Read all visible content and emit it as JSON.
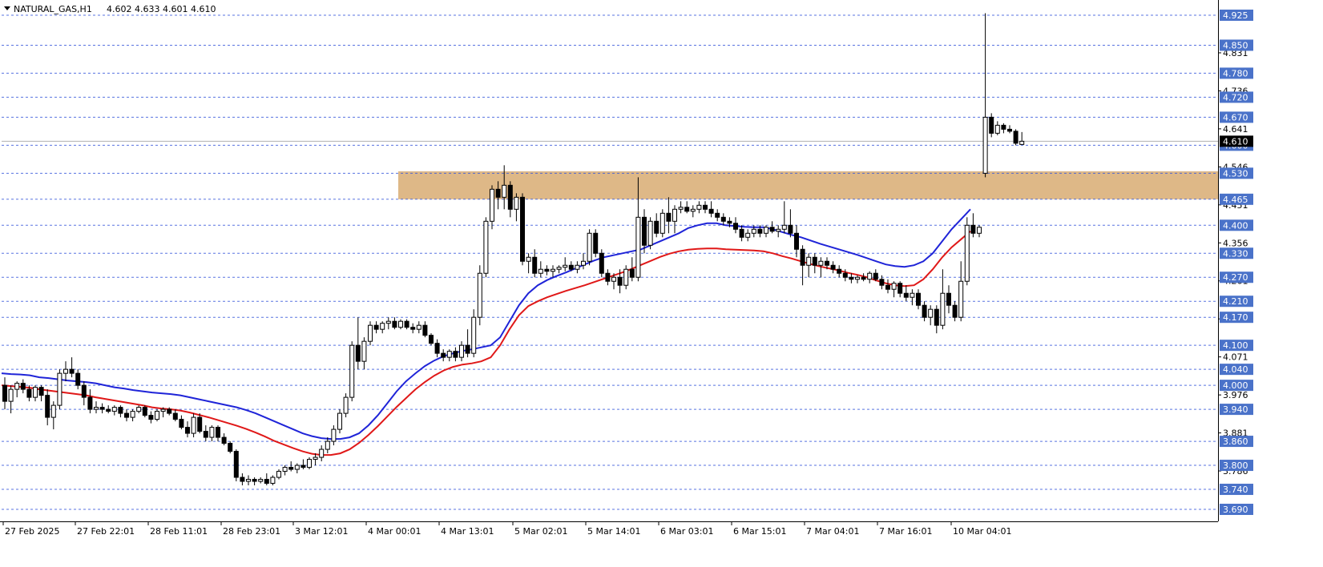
{
  "header": {
    "symbol": "NATURAL_GAS,H1",
    "ohlc": "4.602 4.633 4.601 4.610"
  },
  "colors": {
    "grid_dash": "#3b5bdb",
    "price_tag_bg": "#4a72c9",
    "zone_fill": "#deb887",
    "ema_fast": "#1f24d8",
    "ema_slow": "#e01818",
    "candle": "#000000"
  },
  "chart_data": {
    "type": "candlestick",
    "symbol": "NATURAL_GAS",
    "timeframe": "H1",
    "ylim": [
      3.66,
      4.955
    ],
    "price_levels": [
      4.925,
      4.85,
      4.78,
      4.72,
      4.67,
      4.6,
      4.53,
      4.465,
      4.4,
      4.33,
      4.27,
      4.21,
      4.17,
      4.1,
      4.04,
      4.0,
      3.94,
      3.86,
      3.8,
      3.74,
      3.69
    ],
    "minor_ticks": [
      {
        "label": "4.831",
        "value": 4.831
      },
      {
        "label": "4.736",
        "value": 4.736
      },
      {
        "label": "4.641",
        "value": 4.641
      },
      {
        "label": "4.546",
        "value": 4.546
      },
      {
        "label": "4.451",
        "value": 4.451
      },
      {
        "label": "4.356",
        "value": 4.356
      },
      {
        "label": "4.261",
        "value": 4.261
      },
      {
        "label": "4.166",
        "value": 4.166
      },
      {
        "label": "4.071",
        "value": 4.071
      },
      {
        "label": "3.976",
        "value": 3.976
      },
      {
        "label": "3.881",
        "value": 3.881
      },
      {
        "label": "3.786",
        "value": 3.786
      }
    ],
    "current_price": 4.61,
    "resistance_zone": {
      "low": 4.465,
      "high": 4.535
    },
    "x_labels": [
      "27 Feb 2025",
      "27 Feb 22:01",
      "28 Feb 11:01",
      "28 Feb 23:01",
      "3 Mar 12:01",
      "4 Mar 00:01",
      "4 Mar 13:01",
      "5 Mar 02:01",
      "5 Mar 14:01",
      "6 Mar 03:01",
      "6 Mar 15:01",
      "7 Mar 04:01",
      "7 Mar 16:01",
      "10 Mar 04:01"
    ],
    "candles": [
      [
        4.0,
        4.02,
        3.94,
        3.96
      ],
      [
        3.96,
        4.0,
        3.93,
        3.99
      ],
      [
        3.99,
        4.01,
        3.97,
        4.005
      ],
      [
        4.005,
        4.015,
        3.98,
        3.99
      ],
      [
        3.99,
        4.0,
        3.96,
        3.97
      ],
      [
        3.97,
        4.0,
        3.96,
        3.995
      ],
      [
        3.995,
        4.0,
        3.96,
        3.975
      ],
      [
        3.975,
        3.99,
        3.9,
        3.92
      ],
      [
        3.92,
        3.96,
        3.89,
        3.95
      ],
      [
        3.95,
        4.04,
        3.94,
        4.03
      ],
      [
        4.03,
        4.06,
        4.01,
        4.04
      ],
      [
        4.04,
        4.07,
        4.02,
        4.03
      ],
      [
        4.03,
        4.04,
        3.99,
        4.0
      ],
      [
        4.0,
        4.01,
        3.95,
        3.97
      ],
      [
        3.97,
        3.99,
        3.93,
        3.94
      ],
      [
        3.94,
        3.96,
        3.93,
        3.945
      ],
      [
        3.945,
        3.955,
        3.93,
        3.94
      ],
      [
        3.94,
        3.95,
        3.93,
        3.935
      ],
      [
        3.935,
        3.95,
        3.925,
        3.945
      ],
      [
        3.945,
        3.95,
        3.92,
        3.93
      ],
      [
        3.93,
        3.94,
        3.91,
        3.92
      ],
      [
        3.92,
        3.94,
        3.91,
        3.935
      ],
      [
        3.935,
        3.95,
        3.93,
        3.945
      ],
      [
        3.945,
        3.95,
        3.92,
        3.925
      ],
      [
        3.925,
        3.935,
        3.905,
        3.915
      ],
      [
        3.915,
        3.94,
        3.91,
        3.935
      ],
      [
        3.935,
        3.945,
        3.92,
        3.94
      ],
      [
        3.94,
        3.945,
        3.925,
        3.93
      ],
      [
        3.93,
        3.94,
        3.91,
        3.915
      ],
      [
        3.915,
        3.925,
        3.89,
        3.895
      ],
      [
        3.895,
        3.91,
        3.87,
        3.88
      ],
      [
        3.88,
        3.93,
        3.87,
        3.92
      ],
      [
        3.92,
        3.93,
        3.88,
        3.885
      ],
      [
        3.885,
        3.9,
        3.86,
        3.87
      ],
      [
        3.87,
        3.9,
        3.86,
        3.895
      ],
      [
        3.895,
        3.9,
        3.86,
        3.87
      ],
      [
        3.87,
        3.88,
        3.85,
        3.855
      ],
      [
        3.855,
        3.86,
        3.83,
        3.835
      ],
      [
        3.835,
        3.84,
        3.76,
        3.77
      ],
      [
        3.77,
        3.78,
        3.75,
        3.76
      ],
      [
        3.76,
        3.775,
        3.75,
        3.765
      ],
      [
        3.765,
        3.77,
        3.75,
        3.76
      ],
      [
        3.76,
        3.77,
        3.755,
        3.765
      ],
      [
        3.765,
        3.78,
        3.75,
        3.755
      ],
      [
        3.755,
        3.775,
        3.75,
        3.77
      ],
      [
        3.77,
        3.79,
        3.765,
        3.785
      ],
      [
        3.785,
        3.8,
        3.775,
        3.795
      ],
      [
        3.795,
        3.81,
        3.785,
        3.79
      ],
      [
        3.79,
        3.805,
        3.78,
        3.8
      ],
      [
        3.8,
        3.815,
        3.79,
        3.795
      ],
      [
        3.795,
        3.82,
        3.79,
        3.815
      ],
      [
        3.815,
        3.83,
        3.8,
        3.82
      ],
      [
        3.82,
        3.85,
        3.81,
        3.84
      ],
      [
        3.84,
        3.87,
        3.83,
        3.86
      ],
      [
        3.86,
        3.9,
        3.85,
        3.89
      ],
      [
        3.89,
        3.94,
        3.88,
        3.93
      ],
      [
        3.93,
        3.98,
        3.92,
        3.97
      ],
      [
        3.97,
        4.11,
        3.96,
        4.1
      ],
      [
        4.1,
        4.17,
        4.04,
        4.06
      ],
      [
        4.06,
        4.12,
        4.04,
        4.11
      ],
      [
        4.11,
        4.16,
        4.1,
        4.15
      ],
      [
        4.15,
        4.16,
        4.13,
        4.14
      ],
      [
        4.14,
        4.16,
        4.13,
        4.155
      ],
      [
        4.155,
        4.17,
        4.14,
        4.16
      ],
      [
        4.16,
        4.17,
        4.14,
        4.145
      ],
      [
        4.145,
        4.165,
        4.14,
        4.16
      ],
      [
        4.16,
        4.165,
        4.14,
        4.145
      ],
      [
        4.145,
        4.155,
        4.13,
        4.14
      ],
      [
        4.14,
        4.16,
        4.13,
        4.15
      ],
      [
        4.15,
        4.16,
        4.12,
        4.125
      ],
      [
        4.125,
        4.13,
        4.1,
        4.105
      ],
      [
        4.105,
        4.115,
        4.07,
        4.08
      ],
      [
        4.08,
        4.09,
        4.06,
        4.07
      ],
      [
        4.07,
        4.09,
        4.06,
        4.085
      ],
      [
        4.085,
        4.095,
        4.06,
        4.07
      ],
      [
        4.07,
        4.11,
        4.06,
        4.1
      ],
      [
        4.1,
        4.14,
        4.07,
        4.08
      ],
      [
        4.08,
        4.19,
        4.07,
        4.17
      ],
      [
        4.17,
        4.3,
        4.15,
        4.28
      ],
      [
        4.28,
        4.42,
        4.27,
        4.41
      ],
      [
        4.41,
        4.5,
        4.39,
        4.49
      ],
      [
        4.49,
        4.51,
        4.44,
        4.47
      ],
      [
        4.47,
        4.55,
        4.44,
        4.5
      ],
      [
        4.5,
        4.51,
        4.42,
        4.44
      ],
      [
        4.44,
        4.48,
        4.41,
        4.47
      ],
      [
        4.47,
        4.48,
        4.3,
        4.31
      ],
      [
        4.31,
        4.33,
        4.28,
        4.32
      ],
      [
        4.32,
        4.34,
        4.27,
        4.28
      ],
      [
        4.28,
        4.31,
        4.27,
        4.29
      ],
      [
        4.29,
        4.3,
        4.275,
        4.285
      ],
      [
        4.285,
        4.3,
        4.27,
        4.29
      ],
      [
        4.29,
        4.3,
        4.28,
        4.295
      ],
      [
        4.295,
        4.32,
        4.285,
        4.3
      ],
      [
        4.3,
        4.31,
        4.285,
        4.29
      ],
      [
        4.29,
        4.31,
        4.28,
        4.3
      ],
      [
        4.3,
        4.33,
        4.29,
        4.31
      ],
      [
        4.31,
        4.39,
        4.3,
        4.38
      ],
      [
        4.38,
        4.39,
        4.32,
        4.33
      ],
      [
        4.33,
        4.34,
        4.27,
        4.28
      ],
      [
        4.28,
        4.29,
        4.25,
        4.26
      ],
      [
        4.26,
        4.28,
        4.24,
        4.27
      ],
      [
        4.27,
        4.29,
        4.23,
        4.25
      ],
      [
        4.25,
        4.3,
        4.24,
        4.29
      ],
      [
        4.29,
        4.32,
        4.26,
        4.27
      ],
      [
        4.27,
        4.52,
        4.26,
        4.42
      ],
      [
        4.42,
        4.44,
        4.33,
        4.35
      ],
      [
        4.35,
        4.42,
        4.34,
        4.41
      ],
      [
        4.41,
        4.43,
        4.37,
        4.38
      ],
      [
        4.38,
        4.44,
        4.37,
        4.43
      ],
      [
        4.43,
        4.47,
        4.38,
        4.41
      ],
      [
        4.41,
        4.45,
        4.38,
        4.44
      ],
      [
        4.44,
        4.46,
        4.43,
        4.445
      ],
      [
        4.445,
        4.46,
        4.43,
        4.435
      ],
      [
        4.435,
        4.45,
        4.42,
        4.44
      ],
      [
        4.44,
        4.46,
        4.43,
        4.45
      ],
      [
        4.45,
        4.46,
        4.43,
        4.44
      ],
      [
        4.44,
        4.46,
        4.42,
        4.43
      ],
      [
        4.43,
        4.44,
        4.41,
        4.42
      ],
      [
        4.42,
        4.43,
        4.4,
        4.41
      ],
      [
        4.41,
        4.42,
        4.395,
        4.405
      ],
      [
        4.405,
        4.42,
        4.38,
        4.39
      ],
      [
        4.39,
        4.4,
        4.36,
        4.37
      ],
      [
        4.37,
        4.39,
        4.36,
        4.38
      ],
      [
        4.38,
        4.4,
        4.37,
        4.39
      ],
      [
        4.39,
        4.4,
        4.37,
        4.38
      ],
      [
        4.38,
        4.4,
        4.37,
        4.395
      ],
      [
        4.395,
        4.41,
        4.38,
        4.385
      ],
      [
        4.385,
        4.4,
        4.37,
        4.39
      ],
      [
        4.39,
        4.46,
        4.38,
        4.4
      ],
      [
        4.4,
        4.44,
        4.37,
        4.38
      ],
      [
        4.38,
        4.4,
        4.32,
        4.34
      ],
      [
        4.34,
        4.35,
        4.25,
        4.3
      ],
      [
        4.3,
        4.33,
        4.27,
        4.32
      ],
      [
        4.32,
        4.33,
        4.28,
        4.3
      ],
      [
        4.3,
        4.32,
        4.27,
        4.31
      ],
      [
        4.31,
        4.32,
        4.29,
        4.3
      ],
      [
        4.3,
        4.31,
        4.28,
        4.29
      ],
      [
        4.29,
        4.3,
        4.27,
        4.28
      ],
      [
        4.28,
        4.29,
        4.26,
        4.27
      ],
      [
        4.27,
        4.28,
        4.255,
        4.265
      ],
      [
        4.265,
        4.275,
        4.255,
        4.27
      ],
      [
        4.27,
        4.28,
        4.26,
        4.265
      ],
      [
        4.265,
        4.285,
        4.255,
        4.28
      ],
      [
        4.28,
        4.29,
        4.26,
        4.265
      ],
      [
        4.265,
        4.275,
        4.24,
        4.25
      ],
      [
        4.25,
        4.265,
        4.23,
        4.24
      ],
      [
        4.24,
        4.26,
        4.22,
        4.255
      ],
      [
        4.255,
        4.26,
        4.22,
        4.23
      ],
      [
        4.23,
        4.25,
        4.21,
        4.22
      ],
      [
        4.22,
        4.24,
        4.2,
        4.23
      ],
      [
        4.23,
        4.24,
        4.19,
        4.2
      ],
      [
        4.2,
        4.21,
        4.16,
        4.17
      ],
      [
        4.17,
        4.2,
        4.15,
        4.19
      ],
      [
        4.19,
        4.2,
        4.13,
        4.15
      ],
      [
        4.15,
        4.29,
        4.14,
        4.23
      ],
      [
        4.23,
        4.25,
        4.18,
        4.2
      ],
      [
        4.2,
        4.21,
        4.16,
        4.17
      ],
      [
        4.17,
        4.31,
        4.16,
        4.26
      ],
      [
        4.26,
        4.42,
        4.25,
        4.4
      ],
      [
        4.4,
        4.43,
        4.37,
        4.38
      ],
      [
        4.38,
        4.4,
        4.37,
        4.395
      ],
      [
        4.53,
        4.93,
        4.52,
        4.67
      ],
      [
        4.67,
        4.68,
        4.62,
        4.63
      ],
      [
        4.63,
        4.66,
        4.625,
        4.65
      ],
      [
        4.65,
        4.655,
        4.63,
        4.64
      ],
      [
        4.64,
        4.65,
        4.63,
        4.635
      ],
      [
        4.635,
        4.64,
        4.6,
        4.605
      ],
      [
        4.602,
        4.633,
        4.601,
        4.61
      ]
    ],
    "series": [
      {
        "values": [
          4.03,
          4.028,
          4.027,
          4.025,
          4.02,
          4.018,
          4.015,
          4.012,
          4.01,
          4.008,
          4.005,
          4.0,
          3.995,
          3.992,
          3.988,
          3.985,
          3.982,
          3.98,
          3.978,
          3.975,
          3.97,
          3.965,
          3.96,
          3.955,
          3.95,
          3.945,
          3.938,
          3.93,
          3.92,
          3.91,
          3.9,
          3.89,
          3.88,
          3.873,
          3.868,
          3.866,
          3.866,
          3.87,
          3.88,
          3.9,
          3.925,
          3.955,
          3.985,
          4.01,
          4.03,
          4.048,
          4.062,
          4.073,
          4.08,
          4.086,
          4.09,
          4.095,
          4.1,
          4.12,
          4.16,
          4.2,
          4.23,
          4.25,
          4.263,
          4.273,
          4.282,
          4.292,
          4.302,
          4.312,
          4.32,
          4.325,
          4.33,
          4.335,
          4.34,
          4.35,
          4.36,
          4.37,
          4.38,
          4.393,
          4.4,
          4.405,
          4.405,
          4.4,
          4.398,
          4.396,
          4.395,
          4.395,
          4.39,
          4.383,
          4.376,
          4.37,
          4.362,
          4.354,
          4.347,
          4.34,
          4.333,
          4.326,
          4.318,
          4.31,
          4.302,
          4.298,
          4.296,
          4.3,
          4.31,
          4.33,
          4.36,
          4.39,
          4.415,
          4.44
        ]
      },
      {
        "values": [
          4.0,
          3.998,
          3.996,
          3.994,
          3.99,
          3.987,
          3.984,
          3.981,
          3.978,
          3.975,
          3.97,
          3.966,
          3.962,
          3.958,
          3.954,
          3.95,
          3.945,
          3.942,
          3.94,
          3.937,
          3.932,
          3.926,
          3.92,
          3.913,
          3.906,
          3.899,
          3.891,
          3.882,
          3.872,
          3.861,
          3.852,
          3.843,
          3.835,
          3.829,
          3.826,
          3.826,
          3.83,
          3.84,
          3.856,
          3.876,
          3.898,
          3.922,
          3.946,
          3.968,
          3.99,
          4.008,
          4.024,
          4.037,
          4.046,
          4.052,
          4.055,
          4.06,
          4.07,
          4.1,
          4.14,
          4.175,
          4.198,
          4.21,
          4.22,
          4.228,
          4.236,
          4.243,
          4.25,
          4.258,
          4.266,
          4.274,
          4.282,
          4.291,
          4.301,
          4.311,
          4.321,
          4.329,
          4.335,
          4.339,
          4.341,
          4.342,
          4.342,
          4.34,
          4.339,
          4.338,
          4.337,
          4.335,
          4.33,
          4.323,
          4.317,
          4.31,
          4.303,
          4.297,
          4.292,
          4.287,
          4.281,
          4.276,
          4.27,
          4.262,
          4.255,
          4.25,
          4.248,
          4.25,
          4.265,
          4.29,
          4.32,
          4.345,
          4.365,
          4.385
        ]
      }
    ]
  }
}
